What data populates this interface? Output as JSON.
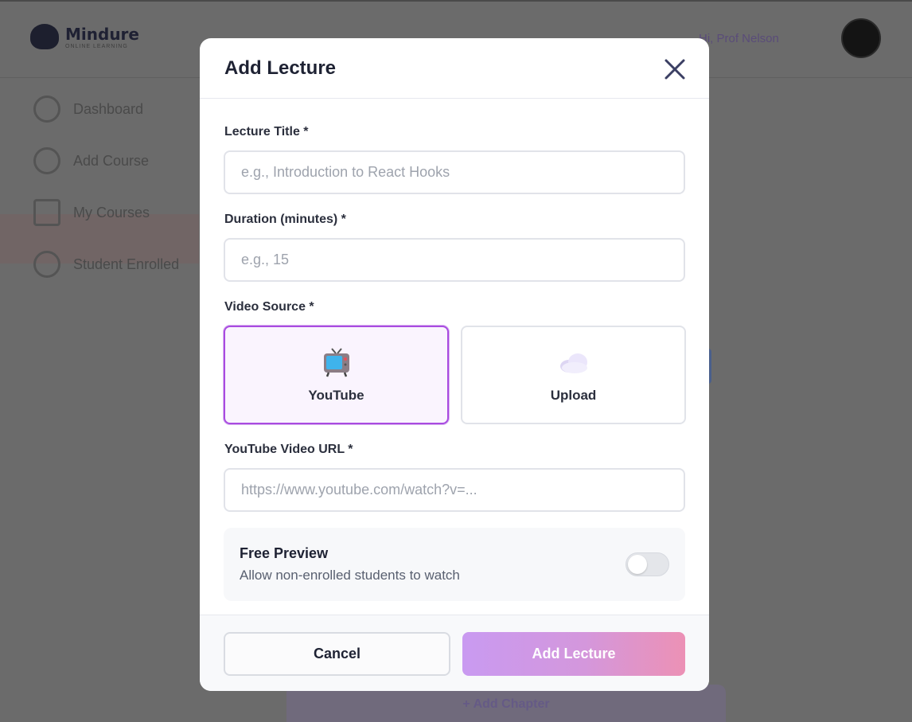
{
  "background": {
    "logo_name": "Mindure",
    "logo_sub": "ONLINE LEARNING",
    "user_name": "Hi, Prof Nelson",
    "sidebar": [
      "Dashboard",
      "Add Course",
      "My Courses",
      "Student Enrolled"
    ],
    "bottom_button": "+ Add Chapter"
  },
  "modal": {
    "title": "Add Lecture",
    "fields": {
      "title": {
        "label": "Lecture Title *",
        "placeholder": "e.g., Introduction to React Hooks",
        "value": ""
      },
      "duration": {
        "label": "Duration (minutes) *",
        "placeholder": "e.g., 15",
        "value": ""
      },
      "video_source": {
        "label": "Video Source *",
        "options": [
          {
            "label": "YouTube",
            "icon": "tv-icon",
            "selected": true
          },
          {
            "label": "Upload",
            "icon": "cloud-icon",
            "selected": false
          }
        ]
      },
      "youtube_url": {
        "label": "YouTube Video URL *",
        "placeholder": "https://www.youtube.com/watch?v=...",
        "value": ""
      }
    },
    "free_preview": {
      "title": "Free Preview",
      "description": "Allow non-enrolled students to watch",
      "enabled": false
    },
    "buttons": {
      "cancel": "Cancel",
      "submit": "Add Lecture"
    }
  },
  "colors": {
    "overlay": "#6a6a6a",
    "selected_border": "#a94be0",
    "selected_bg": "#faf4fe",
    "submit_gradient_start": "#c99af1",
    "submit_gradient_end": "#ec91b5"
  }
}
